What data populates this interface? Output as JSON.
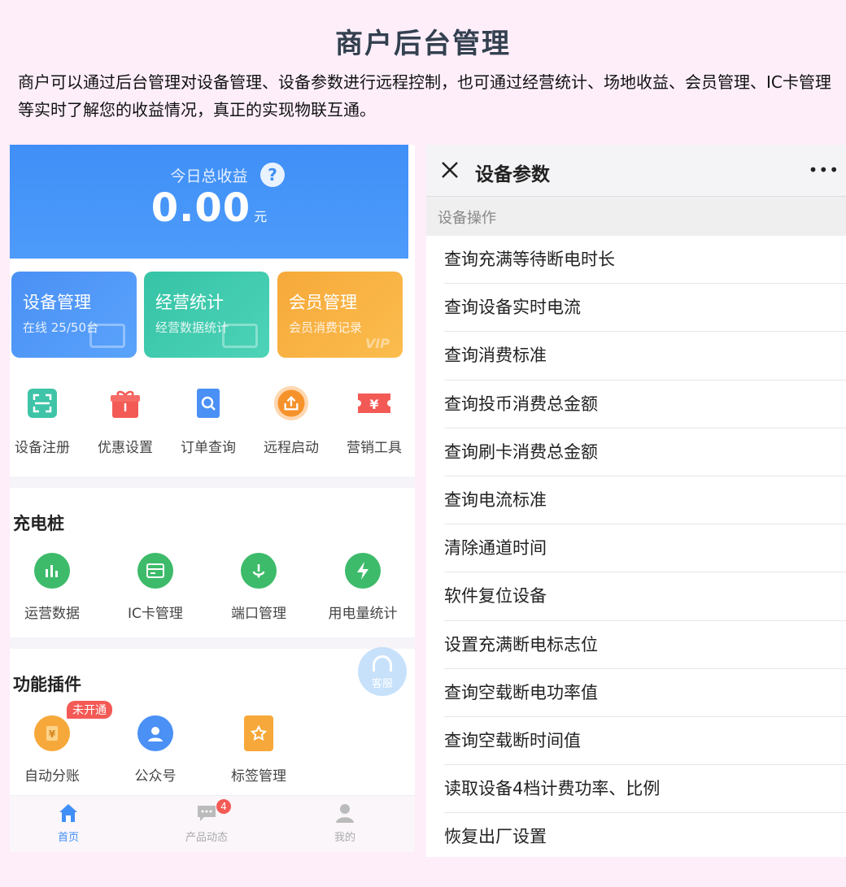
{
  "page": {
    "title": "商户后台管理",
    "description": "商户可以通过后台管理对设备管理、设备参数进行远程控制，也可通过经营统计、场地收益、会员管理、IC卡管理等实时了解您的收益情况，真正的实现物联互通。"
  },
  "left": {
    "banner": {
      "label": "今日总收益",
      "amount": "0.00",
      "unit": "元"
    },
    "cards": [
      {
        "title": "设备管理",
        "subtitle": "在线 25/50台",
        "color": "#4a90f5"
      },
      {
        "title": "经营统计",
        "subtitle": "经营数据统计",
        "color": "#36c3a6"
      },
      {
        "title": "会员管理",
        "subtitle": "会员消费记录",
        "vip": "VIP",
        "color": "#f6a93a"
      }
    ],
    "quick_actions": [
      {
        "label": "设备注册",
        "icon": "scan-icon"
      },
      {
        "label": "优惠设置",
        "icon": "gift-icon"
      },
      {
        "label": "订单查询",
        "icon": "search-doc-icon"
      },
      {
        "label": "远程启动",
        "icon": "upload-icon"
      },
      {
        "label": "营销工具",
        "icon": "ticket-icon"
      }
    ],
    "charging": {
      "title": "充电桩",
      "items": [
        {
          "label": "运营数据",
          "icon": "bar-chart-icon"
        },
        {
          "label": "IC卡管理",
          "icon": "card-icon"
        },
        {
          "label": "端口管理",
          "icon": "port-icon"
        },
        {
          "label": "用电量统计",
          "icon": "lightning-icon"
        }
      ]
    },
    "plugins": {
      "title": "功能插件",
      "badge": "未开通",
      "items": [
        {
          "label": "自动分账",
          "icon": "coin-icon"
        },
        {
          "label": "公众号",
          "icon": "user-icon"
        },
        {
          "label": "标签管理",
          "icon": "tag-icon"
        }
      ]
    },
    "service_button": "客服",
    "tabbar": {
      "items": [
        {
          "label": "首页",
          "icon": "home-icon"
        },
        {
          "label": "产品动态",
          "icon": "chat-icon",
          "badge": "4"
        },
        {
          "label": "我的",
          "icon": "person-icon"
        }
      ]
    }
  },
  "right": {
    "header": {
      "title": "设备参数"
    },
    "section_label": "设备操作",
    "operations": [
      "查询充满等待断电时长",
      "查询设备实时电流",
      "查询消费标准",
      "查询投币消费总金额",
      "查询刷卡消费总金额",
      "查询电流标准",
      "清除通道时间",
      "软件复位设备",
      "设置充满断电标志位",
      "查询空载断电功率值",
      "查询空载断时间值",
      "读取设备4档计费功率、比例",
      "恢复出厂设置"
    ]
  }
}
